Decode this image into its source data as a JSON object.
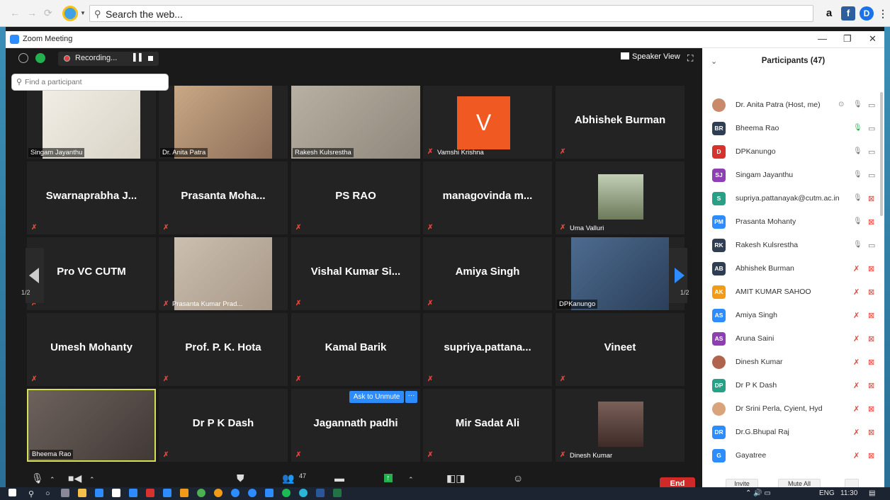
{
  "browser": {
    "search_placeholder": "Search the web...",
    "icons": [
      "back-icon",
      "forward-icon",
      "refresh-icon",
      "ie-logo-icon",
      "amazon-icon",
      "facebook-icon",
      "extension-icon",
      "more-icon"
    ],
    "amazon_glyph": "a",
    "facebook_glyph": "f",
    "ext_glyph": "D",
    "more_glyph": "⋮"
  },
  "window": {
    "title": "Zoom Meeting"
  },
  "meeting_bar": {
    "recording_label": "Recording...",
    "speaker_view_label": "Speaker View"
  },
  "tiles": [
    {
      "name": "Singam Jayanthu",
      "kind": "video"
    },
    {
      "name": "Dr. Anita Patra",
      "kind": "video"
    },
    {
      "name": "Rakesh Kulsrestha",
      "kind": "video"
    },
    {
      "name": "Vamshi Krishna",
      "kind": "avatar",
      "initial": "V"
    },
    {
      "name": "Abhishek Burman",
      "kind": "name"
    },
    {
      "name": "Swarnaprabha J...",
      "kind": "name"
    },
    {
      "name": "Prasanta Moha...",
      "kind": "name"
    },
    {
      "name": "PS RAO",
      "kind": "name"
    },
    {
      "name": "managovinda m...",
      "kind": "name"
    },
    {
      "name": "Uma Valluri",
      "kind": "photo"
    },
    {
      "name": "Pro VC CUTM",
      "kind": "name"
    },
    {
      "name": "Prasanta Kumar Prad...",
      "kind": "video"
    },
    {
      "name": "Vishal Kumar Si...",
      "kind": "name"
    },
    {
      "name": "Amiya Singh",
      "kind": "name"
    },
    {
      "name": "DPKanungo",
      "kind": "video"
    },
    {
      "name": "Umesh Mohanty",
      "kind": "name"
    },
    {
      "name": "Prof. P. K. Hota",
      "kind": "name"
    },
    {
      "name": "Kamal Barik",
      "kind": "name"
    },
    {
      "name": "supriya.pattana...",
      "kind": "name"
    },
    {
      "name": "Vineet",
      "kind": "name"
    },
    {
      "name": "Bheema Rao",
      "kind": "video"
    },
    {
      "name": "Dr P K Dash",
      "kind": "name"
    },
    {
      "name": "Jagannath padhi",
      "kind": "name"
    },
    {
      "name": "Mir Sadat Ali",
      "kind": "name"
    },
    {
      "name": "Dinesh Kumar",
      "kind": "photo"
    }
  ],
  "pagination": {
    "left": "1/2",
    "right": "1/2"
  },
  "unmute": {
    "label": "Ask to Unmute",
    "more": "···"
  },
  "toolbar": {
    "participants_count": "47",
    "end_label": "End"
  },
  "panel": {
    "title": "Participants (47)",
    "search_placeholder": "Find a participant",
    "participants": [
      {
        "name": "Dr. Anita Patra (Host, me)",
        "initials": "",
        "color": "#c88a6a",
        "mic": "on",
        "cam": "off",
        "host": true
      },
      {
        "name": "Bheema Rao",
        "initials": "BR",
        "color": "#2f3e52",
        "mic": "active",
        "cam": "off"
      },
      {
        "name": "DPKanungo",
        "initials": "D",
        "color": "#d7322d",
        "mic": "on",
        "cam": "off"
      },
      {
        "name": "Singam Jayanthu",
        "initials": "SJ",
        "color": "#8e3fb3",
        "mic": "on",
        "cam": "off"
      },
      {
        "name": "supriya.pattanayak@cutm.ac.in",
        "initials": "S",
        "color": "#27a085",
        "mic": "on",
        "cam": "muted"
      },
      {
        "name": "Prasanta Mohanty",
        "initials": "PM",
        "color": "#2d8cff",
        "mic": "on",
        "cam": "muted"
      },
      {
        "name": "Rakesh Kulsrestha",
        "initials": "RK",
        "color": "#2f3e52",
        "mic": "on",
        "cam": "off"
      },
      {
        "name": "Abhishek Burman",
        "initials": "AB",
        "color": "#2f3e52",
        "mic": "muted",
        "cam": "muted"
      },
      {
        "name": "AMIT KUMAR SAHOO",
        "initials": "AK",
        "color": "#f39b16",
        "mic": "muted",
        "cam": "muted"
      },
      {
        "name": "Amiya Singh",
        "initials": "AS",
        "color": "#2d8cff",
        "mic": "muted",
        "cam": "muted"
      },
      {
        "name": "Aruna Saini",
        "initials": "AS",
        "color": "#8e3fb3",
        "mic": "muted",
        "cam": "muted"
      },
      {
        "name": "Dinesh Kumar",
        "initials": "",
        "color": "#b0644e",
        "mic": "muted",
        "cam": "muted"
      },
      {
        "name": "Dr P K Dash",
        "initials": "DP",
        "color": "#27a085",
        "mic": "muted",
        "cam": "muted"
      },
      {
        "name": "Dr Srini Perla, Cyient, Hyd",
        "initials": "",
        "color": "#d9a47a",
        "mic": "muted",
        "cam": "muted"
      },
      {
        "name": "Dr.G.Bhupal Raj",
        "initials": "DR",
        "color": "#2d8cff",
        "mic": "muted",
        "cam": "muted"
      },
      {
        "name": "Gayatree",
        "initials": "G",
        "color": "#2d8cff",
        "mic": "muted",
        "cam": "muted"
      }
    ],
    "invite_label": "Invite",
    "mute_all_label": "Mute All"
  },
  "taskbar": {
    "lang": "ENG",
    "time": "11:30"
  }
}
